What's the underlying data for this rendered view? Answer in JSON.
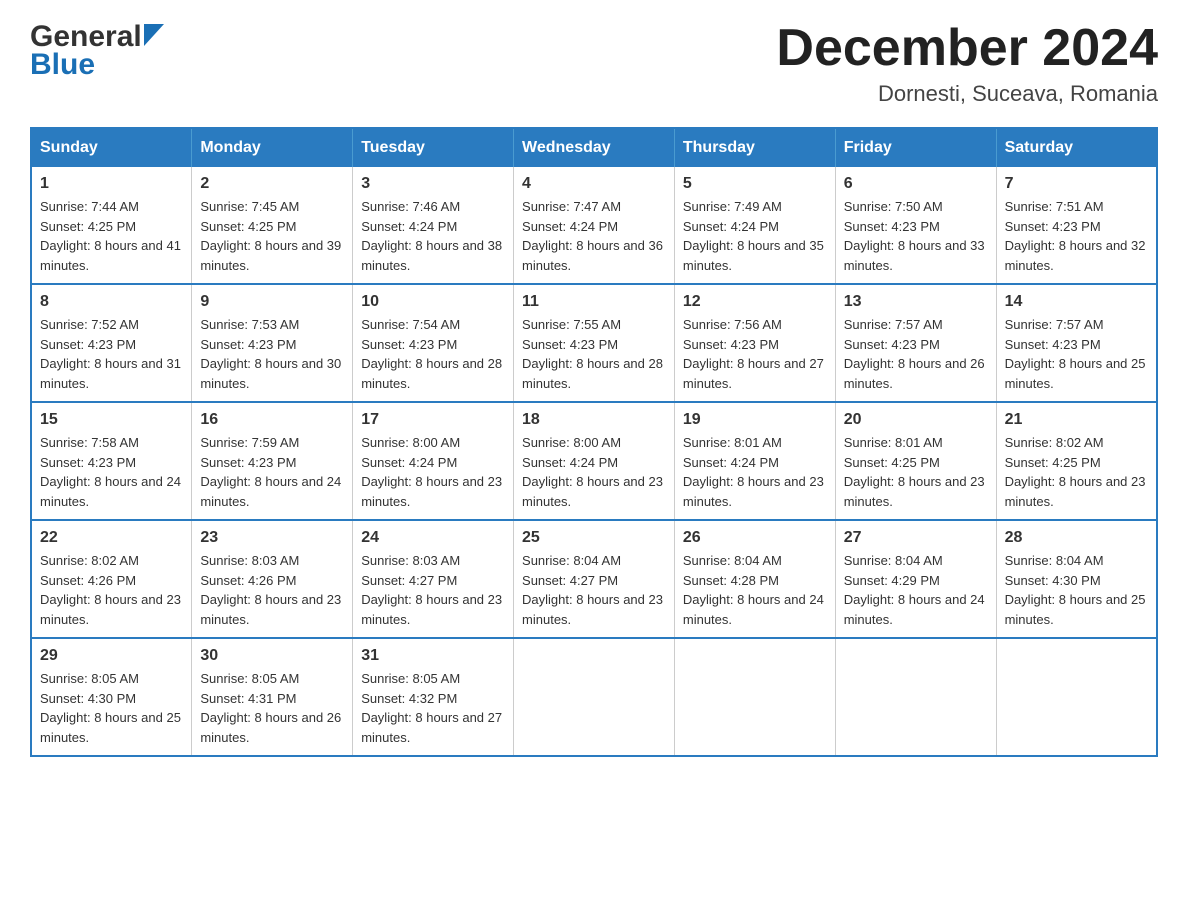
{
  "header": {
    "logo_general": "General",
    "logo_blue": "Blue",
    "month_title": "December 2024",
    "location": "Dornesti, Suceava, Romania"
  },
  "calendar": {
    "days_of_week": [
      "Sunday",
      "Monday",
      "Tuesday",
      "Wednesday",
      "Thursday",
      "Friday",
      "Saturday"
    ],
    "weeks": [
      [
        {
          "date": "1",
          "sunrise": "7:44 AM",
          "sunset": "4:25 PM",
          "daylight": "8 hours and 41 minutes."
        },
        {
          "date": "2",
          "sunrise": "7:45 AM",
          "sunset": "4:25 PM",
          "daylight": "8 hours and 39 minutes."
        },
        {
          "date": "3",
          "sunrise": "7:46 AM",
          "sunset": "4:24 PM",
          "daylight": "8 hours and 38 minutes."
        },
        {
          "date": "4",
          "sunrise": "7:47 AM",
          "sunset": "4:24 PM",
          "daylight": "8 hours and 36 minutes."
        },
        {
          "date": "5",
          "sunrise": "7:49 AM",
          "sunset": "4:24 PM",
          "daylight": "8 hours and 35 minutes."
        },
        {
          "date": "6",
          "sunrise": "7:50 AM",
          "sunset": "4:23 PM",
          "daylight": "8 hours and 33 minutes."
        },
        {
          "date": "7",
          "sunrise": "7:51 AM",
          "sunset": "4:23 PM",
          "daylight": "8 hours and 32 minutes."
        }
      ],
      [
        {
          "date": "8",
          "sunrise": "7:52 AM",
          "sunset": "4:23 PM",
          "daylight": "8 hours and 31 minutes."
        },
        {
          "date": "9",
          "sunrise": "7:53 AM",
          "sunset": "4:23 PM",
          "daylight": "8 hours and 30 minutes."
        },
        {
          "date": "10",
          "sunrise": "7:54 AM",
          "sunset": "4:23 PM",
          "daylight": "8 hours and 28 minutes."
        },
        {
          "date": "11",
          "sunrise": "7:55 AM",
          "sunset": "4:23 PM",
          "daylight": "8 hours and 28 minutes."
        },
        {
          "date": "12",
          "sunrise": "7:56 AM",
          "sunset": "4:23 PM",
          "daylight": "8 hours and 27 minutes."
        },
        {
          "date": "13",
          "sunrise": "7:57 AM",
          "sunset": "4:23 PM",
          "daylight": "8 hours and 26 minutes."
        },
        {
          "date": "14",
          "sunrise": "7:57 AM",
          "sunset": "4:23 PM",
          "daylight": "8 hours and 25 minutes."
        }
      ],
      [
        {
          "date": "15",
          "sunrise": "7:58 AM",
          "sunset": "4:23 PM",
          "daylight": "8 hours and 24 minutes."
        },
        {
          "date": "16",
          "sunrise": "7:59 AM",
          "sunset": "4:23 PM",
          "daylight": "8 hours and 24 minutes."
        },
        {
          "date": "17",
          "sunrise": "8:00 AM",
          "sunset": "4:24 PM",
          "daylight": "8 hours and 23 minutes."
        },
        {
          "date": "18",
          "sunrise": "8:00 AM",
          "sunset": "4:24 PM",
          "daylight": "8 hours and 23 minutes."
        },
        {
          "date": "19",
          "sunrise": "8:01 AM",
          "sunset": "4:24 PM",
          "daylight": "8 hours and 23 minutes."
        },
        {
          "date": "20",
          "sunrise": "8:01 AM",
          "sunset": "4:25 PM",
          "daylight": "8 hours and 23 minutes."
        },
        {
          "date": "21",
          "sunrise": "8:02 AM",
          "sunset": "4:25 PM",
          "daylight": "8 hours and 23 minutes."
        }
      ],
      [
        {
          "date": "22",
          "sunrise": "8:02 AM",
          "sunset": "4:26 PM",
          "daylight": "8 hours and 23 minutes."
        },
        {
          "date": "23",
          "sunrise": "8:03 AM",
          "sunset": "4:26 PM",
          "daylight": "8 hours and 23 minutes."
        },
        {
          "date": "24",
          "sunrise": "8:03 AM",
          "sunset": "4:27 PM",
          "daylight": "8 hours and 23 minutes."
        },
        {
          "date": "25",
          "sunrise": "8:04 AM",
          "sunset": "4:27 PM",
          "daylight": "8 hours and 23 minutes."
        },
        {
          "date": "26",
          "sunrise": "8:04 AM",
          "sunset": "4:28 PM",
          "daylight": "8 hours and 24 minutes."
        },
        {
          "date": "27",
          "sunrise": "8:04 AM",
          "sunset": "4:29 PM",
          "daylight": "8 hours and 24 minutes."
        },
        {
          "date": "28",
          "sunrise": "8:04 AM",
          "sunset": "4:30 PM",
          "daylight": "8 hours and 25 minutes."
        }
      ],
      [
        {
          "date": "29",
          "sunrise": "8:05 AM",
          "sunset": "4:30 PM",
          "daylight": "8 hours and 25 minutes."
        },
        {
          "date": "30",
          "sunrise": "8:05 AM",
          "sunset": "4:31 PM",
          "daylight": "8 hours and 26 minutes."
        },
        {
          "date": "31",
          "sunrise": "8:05 AM",
          "sunset": "4:32 PM",
          "daylight": "8 hours and 27 minutes."
        },
        null,
        null,
        null,
        null
      ]
    ],
    "sunrise_label": "Sunrise:",
    "sunset_label": "Sunset:",
    "daylight_label": "Daylight:"
  }
}
